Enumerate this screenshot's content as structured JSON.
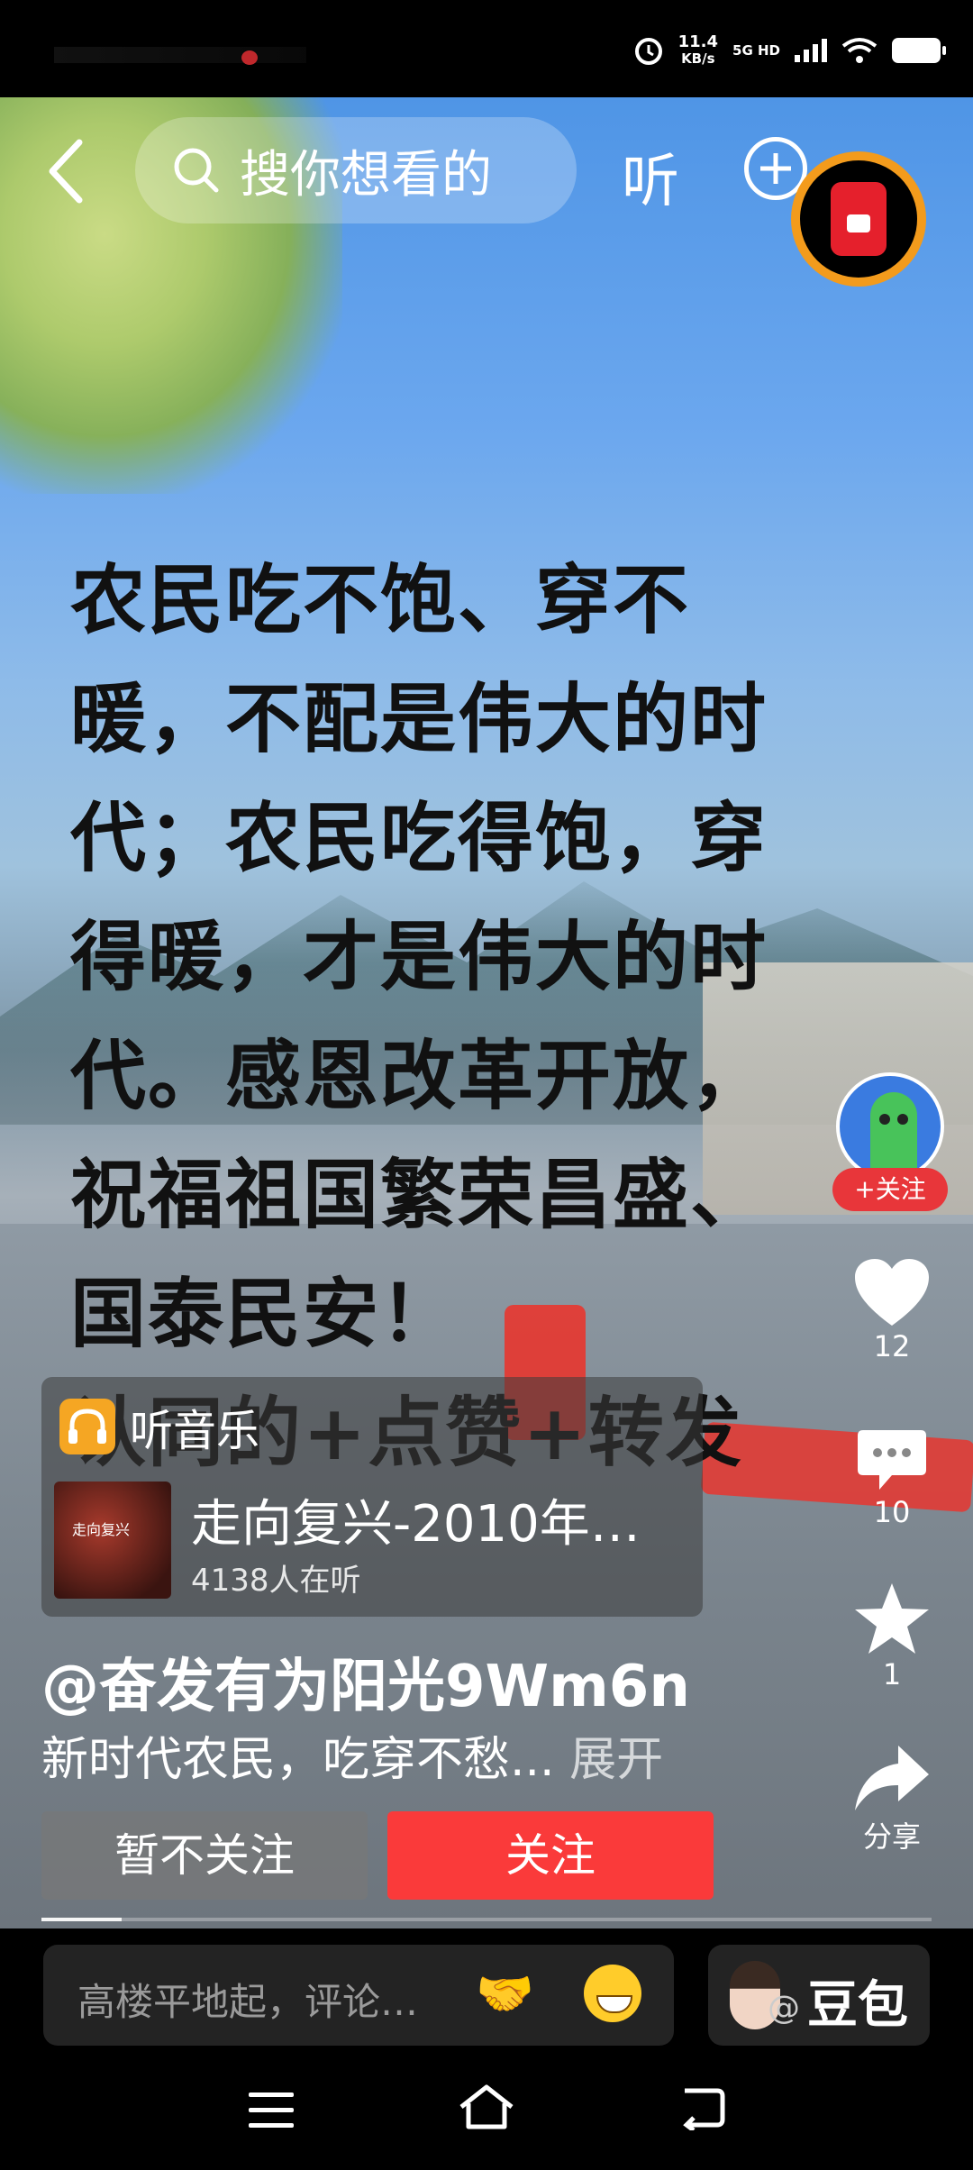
{
  "status_bar": {
    "net_speed": "11.4",
    "net_speed_unit": "KB/s",
    "network": "5G HD"
  },
  "top_bar": {
    "search_placeholder": "搜你想看的",
    "listen_label": "听"
  },
  "video_caption": {
    "lines": [
      "农民吃不饱、穿不",
      "暖，不配是伟大的时",
      "代；农民吃得饱，穿",
      "得暖，才是伟大的时",
      "代。感恩改革开放，",
      "祝福祖国繁荣昌盛、",
      "国泰民安！",
      "认同的+点赞+转发"
    ]
  },
  "actions": {
    "follow_pill": "+关注",
    "likes": "12",
    "comments": "10",
    "favorites": "1",
    "share": "分享"
  },
  "music_card": {
    "title": "听音乐",
    "album_text": "走向复兴",
    "song": "走向复兴-2010年…",
    "listeners": "4138人在听"
  },
  "post": {
    "author": "@奋发有为阳光9Wm6n",
    "description": "新时代农民，吃穿不愁...",
    "expand": "展开"
  },
  "buttons": {
    "no_follow": "暂不关注",
    "follow": "关注"
  },
  "progress": {
    "value": 0.09
  },
  "bottom_bar": {
    "comment_placeholder": "高楼平地起，评论…",
    "doubao_label": "豆包",
    "doubao_at": "@"
  },
  "colors": {
    "accent_red": "#fa3a3a",
    "ring_orange": "#f39b1c"
  }
}
